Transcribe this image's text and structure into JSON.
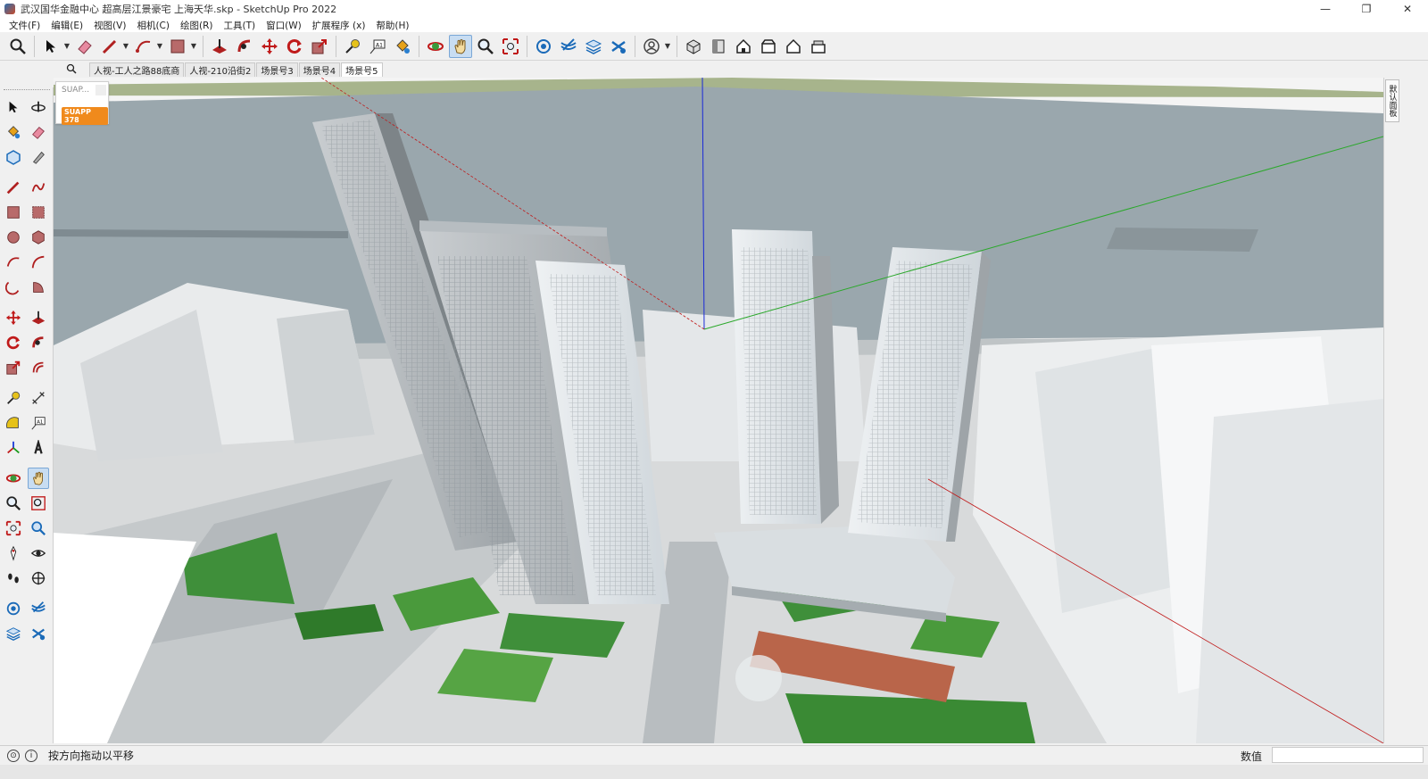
{
  "window": {
    "title": "武汉国华金融中心 超高层江景豪宅 上海天华.skp - SketchUp Pro 2022",
    "minimize": "—",
    "restore": "❐",
    "close": "✕"
  },
  "menu": {
    "items": [
      "文件(F)",
      "编辑(E)",
      "视图(V)",
      "相机(C)",
      "绘图(R)",
      "工具(T)",
      "窗口(W)",
      "扩展程序 (x)",
      "帮助(H)"
    ]
  },
  "scenes": {
    "tabs": [
      "人视-工人之路88底商",
      "人视-210沿街2",
      "场景号3",
      "场景号4",
      "场景号5"
    ],
    "active_index": 4
  },
  "suapp": {
    "title": "SUAP...",
    "badge": "SUAPP 378"
  },
  "tray": {
    "tab_label": "默认面板"
  },
  "status": {
    "hint": "按方向拖动以平移",
    "measurements_label": "数值",
    "measurements_value": ""
  },
  "colors": {
    "accent": "#c8ddf2",
    "river": "#9aa7ad",
    "grass": "#3f8f3a"
  }
}
